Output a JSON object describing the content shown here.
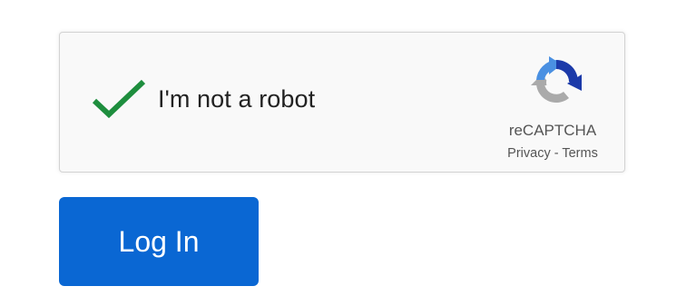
{
  "recaptcha": {
    "label": "I'm not a robot",
    "checked": true,
    "checkmark_icon": "checkmark-icon",
    "check_color": "#1e8e3e",
    "brand_name": "reCAPTCHA",
    "logo_icon": "recaptcha-logo-icon",
    "privacy_label": "Privacy",
    "separator": "-",
    "terms_label": "Terms"
  },
  "login": {
    "button_label": "Log In",
    "button_color": "#0a67d3"
  }
}
